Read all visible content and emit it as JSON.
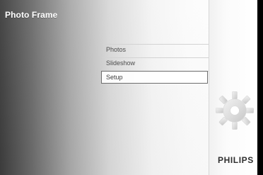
{
  "app": {
    "title": "Photo Frame"
  },
  "menu": {
    "items": [
      {
        "label": "Photos"
      },
      {
        "label": "Slideshow"
      },
      {
        "label": "Setup",
        "selected": true
      }
    ]
  },
  "side": {
    "icon": "gear-icon"
  },
  "brand": {
    "name": "PHILIPS"
  },
  "colors": {
    "selection_border": "#6d6d6d",
    "text_dark": "#4c4c4c",
    "brand_text": "#2f2f2f"
  }
}
